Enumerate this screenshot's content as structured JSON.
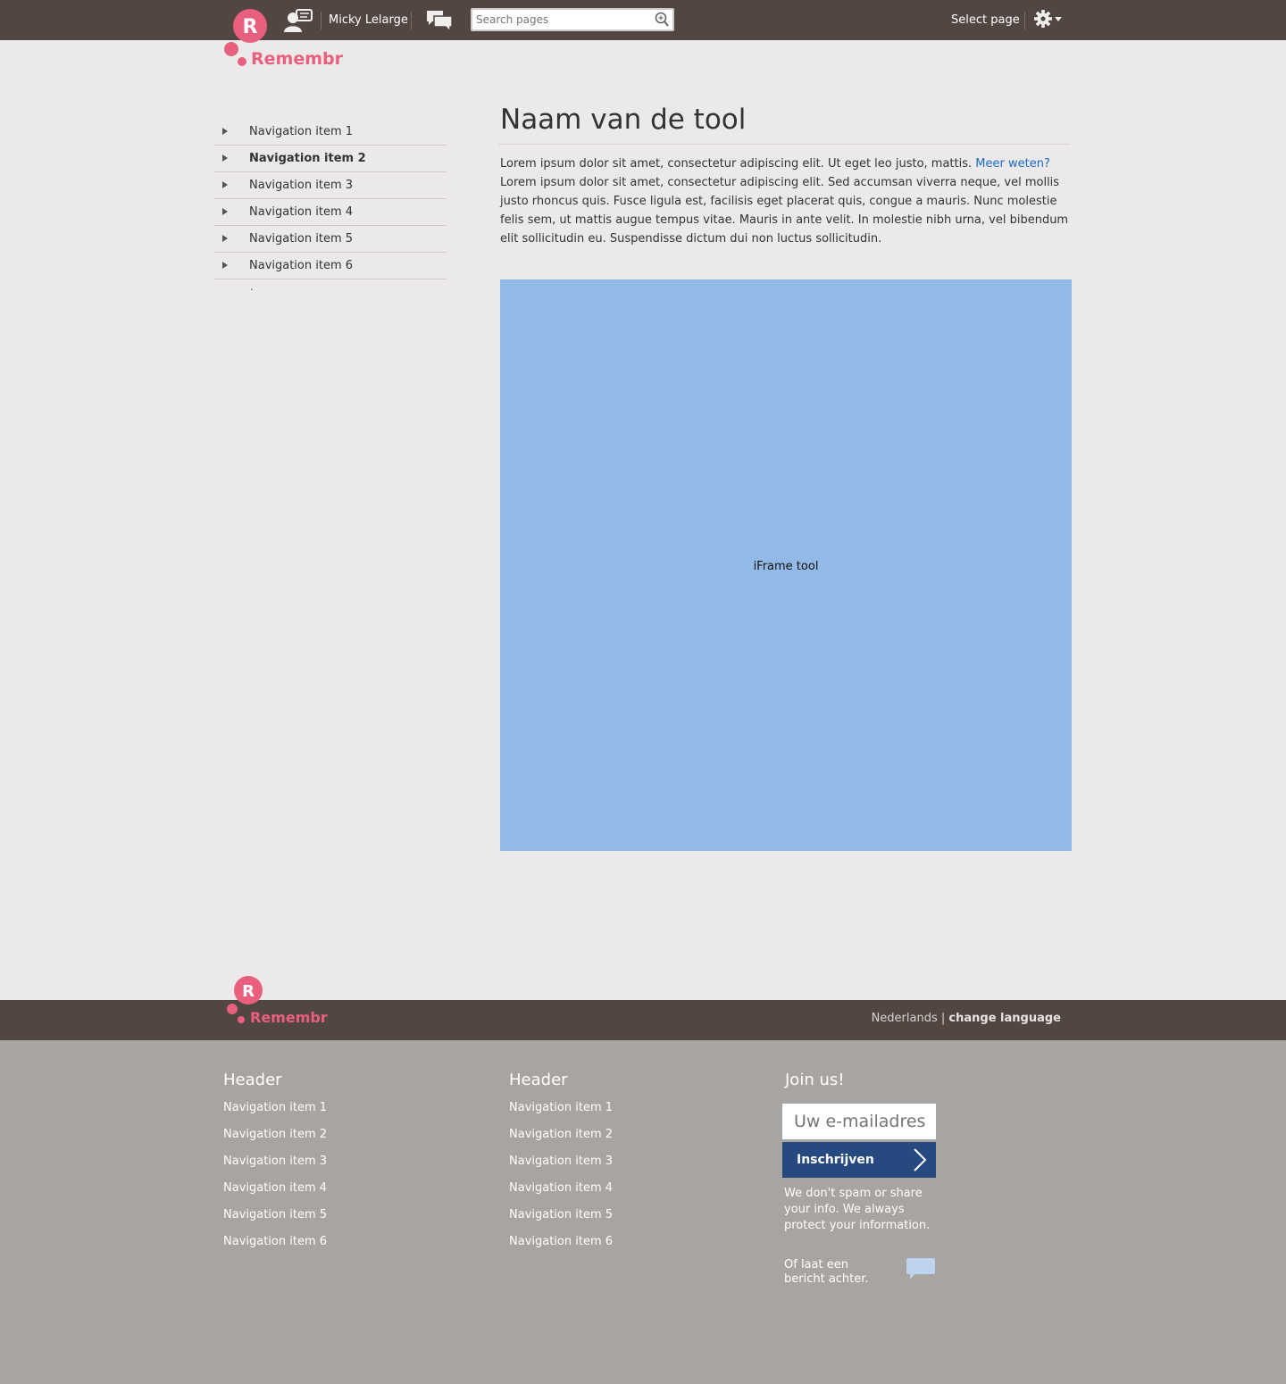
{
  "header": {
    "brand": "Remembr",
    "user_name": "Micky Lelarge",
    "search_placeholder": "Search pages",
    "select_page": "Select page"
  },
  "sidenav": {
    "items": [
      {
        "label": "Navigation item 1"
      },
      {
        "label": "Navigation item 2",
        "active": true
      },
      {
        "label": "Navigation item 3"
      },
      {
        "label": "Navigation item 4"
      },
      {
        "label": "Navigation item 5"
      },
      {
        "label": "Navigation item 6"
      }
    ],
    "trailing_dot": "."
  },
  "main": {
    "title": "Naam van de tool",
    "intro_part1": "Lorem ipsum dolor sit amet, consectetur adipiscing elit. Ut eget leo justo, mattis.",
    "link": "Meer weten?",
    "intro_part2": "Lorem ipsum dolor sit amet, consectetur adipiscing elit. Sed accumsan viverra neque, vel mollis justo rhoncus quis. Fusce ligula est, facilisis eget placerat quis, congue a mauris. Nunc molestie felis sem, ut mattis augue tempus vitae. Mauris in ante velit. In molestie nibh urna, vel bibendum elit sollicitudin eu. Suspendisse dictum dui non luctus sollicitudin.",
    "iframe_label": "iFrame tool"
  },
  "footer_bar": {
    "brand": "Remembr",
    "language": "Nederlands",
    "divider": "|",
    "change_language": "change language"
  },
  "footer": {
    "columns": [
      {
        "header": "Header",
        "items": [
          "Navigation item 1",
          "Navigation item 2",
          "Navigation item 3",
          "Navigation item 4",
          "Navigation item 5",
          "Navigation item 6"
        ]
      },
      {
        "header": "Header",
        "items": [
          "Navigation item 1",
          "Navigation item 2",
          "Navigation item 3",
          "Navigation item 4",
          "Navigation item 5",
          "Navigation item 6"
        ]
      }
    ],
    "join": {
      "header": "Join us!",
      "email_placeholder": "Uw e-mailadres",
      "button": "Inschrijven",
      "disclaimer": "We don't spam or share your info. We always protect your information.",
      "leave_message": "Of laat een bericht achter."
    }
  },
  "colors": {
    "topbar": "#524643",
    "brand_pink": "#e8607e",
    "link": "#1a6bc4",
    "iframe": "#91bae6",
    "footer": "#a8a4a1",
    "button": "#264a80"
  }
}
